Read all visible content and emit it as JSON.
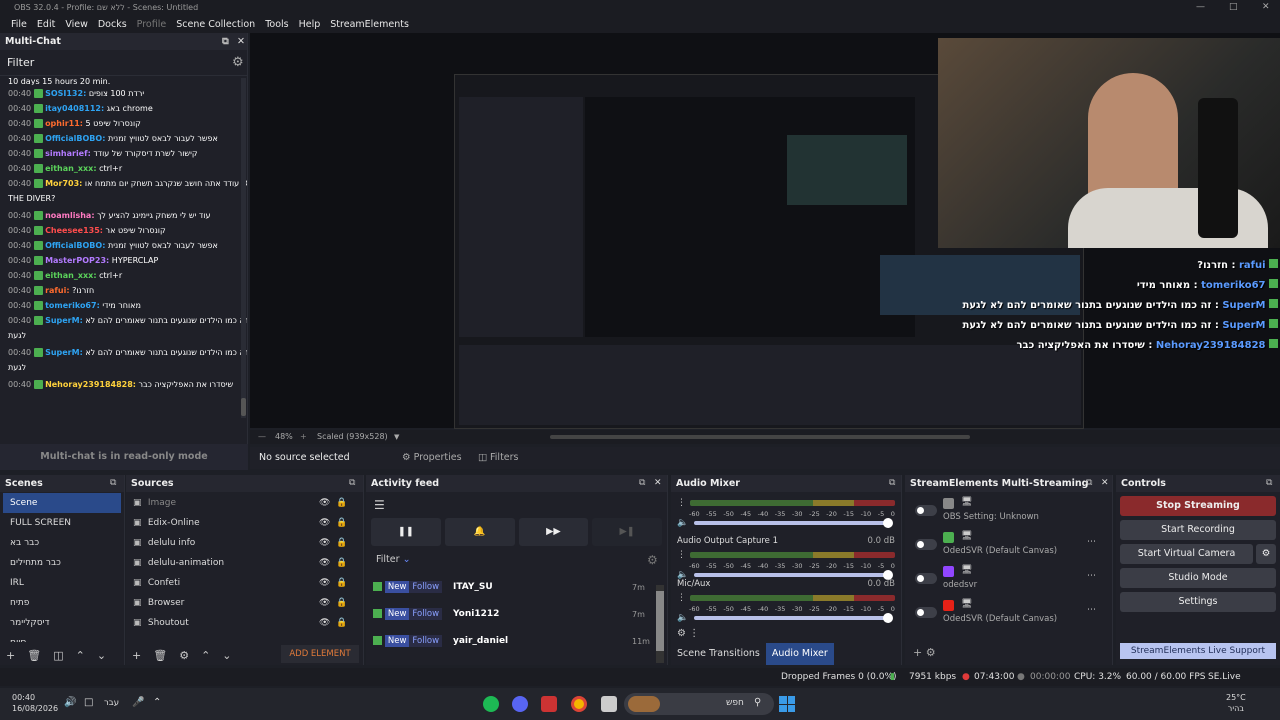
{
  "window": {
    "title": "OBS 32.0.4 - Profile: ללא שם - Scenes: Untitled"
  },
  "menu": [
    "File",
    "Edit",
    "View",
    "Docks",
    "Profile",
    "Scene Collection",
    "Tools",
    "Help",
    "StreamElements"
  ],
  "multichat": {
    "title": "Multi-Chat",
    "filter_label": "Filter",
    "top_partial": "10 days 15 hours 20 min.",
    "messages": [
      {
        "time": "00:40",
        "user": "SOSI132:",
        "text": "ירדת 100 צופים",
        "color": "#2ea3f2"
      },
      {
        "time": "00:40",
        "user": "itay0408112:",
        "text": "באג chrome",
        "color": "#2ea3f2"
      },
      {
        "time": "00:40",
        "user": "ophir11:",
        "text": "קונסרול שיפט 5",
        "color": "#ff6b2e"
      },
      {
        "time": "00:40",
        "user": "OfficialBOBO:",
        "text": "אפשר לעבור לבאס לטוויץ זמנית",
        "color": "#2ea3f2"
      },
      {
        "time": "00:40",
        "user": "simharief:",
        "text": "קישור לשרת דיסקורד של עודד",
        "color": "#b37bff"
      },
      {
        "time": "00:40",
        "user": "eithan_xxx:",
        "text": "ctrl+r",
        "color": "#5bd35b"
      },
      {
        "time": "00:40",
        "user": "Mor703:",
        "text": "עודד אתה חושב שנקרגב תשחק יום מתמח או DAVE",
        "color": "#ffd23c"
      },
      {
        "time": "",
        "user": "",
        "text": "THE DIVER?",
        "color": "#fff"
      },
      {
        "time": "00:40",
        "user": "noamlisha:",
        "text": "עוד יש לי משחק גיימינג להציע לך",
        "color": "#ff7ac2"
      },
      {
        "time": "00:40",
        "user": "Cheesee135:",
        "text": "קונסרול שיפט אר",
        "color": "#ff4d4d"
      },
      {
        "time": "00:40",
        "user": "OfficialBOBO:",
        "text": "אפשר לעבור לבאס לטוויץ זמנית",
        "color": "#2ea3f2"
      },
      {
        "time": "00:40",
        "user": "MasterPOP23:",
        "text": "HYPERCLAP",
        "color": "#b37bff"
      },
      {
        "time": "00:40",
        "user": "eithan_xxx:",
        "text": "ctrl+r",
        "color": "#5bd35b"
      },
      {
        "time": "00:40",
        "user": "rafui:",
        "text": "?חזרנו",
        "color": "#ff6b2e"
      },
      {
        "time": "00:40",
        "user": "tomeriko67:",
        "text": "מאוחר מידי",
        "color": "#2ea3f2"
      },
      {
        "time": "00:40",
        "user": "SuperM:",
        "text": "זה כמו הילדים שנוגעים בתנור שאומרים להם לא",
        "color": "#2ea3f2"
      },
      {
        "time": "",
        "user": "",
        "text": "לגעת",
        "color": "#fff"
      },
      {
        "time": "00:40",
        "user": "SuperM:",
        "text": "זה כמו הילדים שנוגעים בתנור שאומרים להם לא",
        "color": "#2ea3f2"
      },
      {
        "time": "",
        "user": "",
        "text": "לגעת",
        "color": "#fff"
      },
      {
        "time": "00:40",
        "user": "Nehoray239184828:",
        "text": "שיסדרו את האפליקציה כבר",
        "color": "#ffd23c"
      }
    ],
    "readonly_notice": "Multi-chat is in read-only mode"
  },
  "preview": {
    "zoom": "48%",
    "scale": "Scaled (939x528)",
    "overlay_chat": [
      {
        "user": "rafui",
        "text": "?חזרנו :"
      },
      {
        "user": "tomeriko67",
        "text": "מאוחר מידי :"
      },
      {
        "user": "SuperM",
        "text": "זה כמו הילדים שנוגעים בתנור שאומרים להם לא לגעת :"
      },
      {
        "user": "SuperM",
        "text": "זה כמו הילדים שנוגעים בתנור שאומרים להם לא לגעת :"
      },
      {
        "user": "Nehoray239184828",
        "text": "שיסדרו את האפליקציה כבר :"
      }
    ]
  },
  "source_bar": {
    "no_source": "No source selected",
    "properties": "Properties",
    "filters": "Filters"
  },
  "scenes": {
    "title": "Scenes",
    "items": [
      "Scene",
      "FULL SCREEN",
      "כבר בא",
      "כבר מתחילים",
      "IRL",
      "פתיח",
      "דיסקליימר",
      "סיום"
    ]
  },
  "sources": {
    "title": "Sources",
    "items": [
      "Image",
      "Edix-Online",
      "delulu info",
      "delulu-animation",
      "Confeti",
      "Browser",
      "Shoutout"
    ],
    "add_element": "ADD ELEMENT"
  },
  "activity": {
    "title": "Activity feed",
    "filter": "Filter",
    "rows": [
      {
        "badge1": "New",
        "badge2": "Follow",
        "name": "ITAY_SU",
        "time": "7m"
      },
      {
        "badge1": "New",
        "badge2": "Follow",
        "name": "Yoni1212",
        "time": "7m"
      },
      {
        "badge1": "New",
        "badge2": "Follow",
        "name": "yair_daniel",
        "time": "11m"
      }
    ]
  },
  "mixer": {
    "title": "Audio Mixer",
    "scale": [
      "-60",
      "-55",
      "-50",
      "-45",
      "-40",
      "-35",
      "-30",
      "-25",
      "-20",
      "-15",
      "-10",
      "-5",
      "0"
    ],
    "channels": [
      {
        "name": "",
        "db": ""
      },
      {
        "name": "Audio Output Capture 1",
        "db": "0.0 dB"
      },
      {
        "name": "Mic/Aux",
        "db": "0.0 dB"
      }
    ],
    "tab_transitions": "Scene Transitions",
    "tab_mixer": "Audio Mixer"
  },
  "multistream": {
    "title": "StreamElements Multi-Streaming",
    "rows": [
      {
        "label": "OBS Setting: Unknown"
      },
      {
        "label": "OdedSVR (Default Canvas)"
      },
      {
        "label": "odedsvr"
      },
      {
        "label": "OdedSVR (Default Canvas)"
      }
    ]
  },
  "controls": {
    "title": "Controls",
    "buttons": [
      "Stop Streaming",
      "Start Recording",
      "Start Virtual Camera",
      "Studio Mode",
      "Settings"
    ],
    "support": "StreamElements Live Support"
  },
  "status": {
    "dropped": "Dropped Frames 0 (0.0%)",
    "kbps": "7951 kbps",
    "live_time": "07:43:00",
    "rec_time": "00:00:00",
    "cpu": "CPU: 3.2%",
    "fps": "60.00 / 60.00 FPS",
    "version": "SE.Live 26.2.5.549"
  },
  "taskbar": {
    "time": "00:40",
    "date": "16/08/2026",
    "lang": "עבר",
    "search": "חפש",
    "weather_temp": "25°C",
    "weather_desc": "בהיר"
  }
}
